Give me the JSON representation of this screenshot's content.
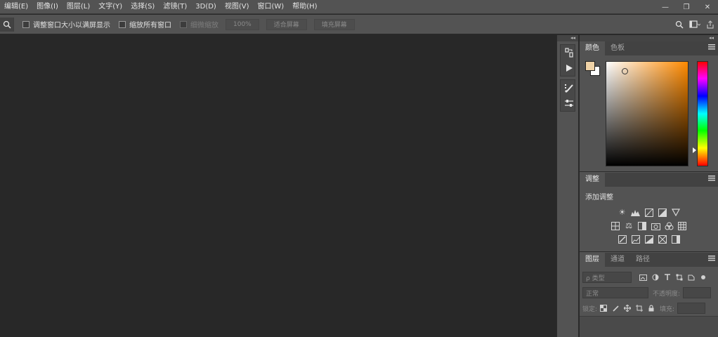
{
  "menu": [
    "编辑(E)",
    "图像(I)",
    "图层(L)",
    "文字(Y)",
    "选择(S)",
    "滤镜(T)",
    "3D(D)",
    "视图(V)",
    "窗口(W)",
    "帮助(H)"
  ],
  "window_controls": {
    "minimize": "—",
    "restore": "❐",
    "close": "✕"
  },
  "options": {
    "resize_window": "调整窗口大小以满屏显示",
    "zoom_all": "缩放所有窗口",
    "scrubby_zoom": "细微缩放",
    "zoom_100": "100%",
    "fit_screen": "适合屏幕",
    "fill_screen": "填充屏幕"
  },
  "collapse_glyph": "◂◂",
  "color_panel": {
    "tabs": [
      "颜色",
      "色板"
    ],
    "fg_color": "#efd2a6",
    "bg_color": "#ffffff",
    "hue_color": "#ff8a00"
  },
  "adjust_panel": {
    "tab": "调整",
    "title": "添加调整"
  },
  "layers_panel": {
    "tabs": [
      "图层",
      "通道",
      "路径"
    ],
    "filter_placeholder": "ρ 类型",
    "blend_mode": "正常",
    "opacity_label": "不透明度:",
    "lock_label": "锁定:",
    "fill_label": "填充:"
  }
}
